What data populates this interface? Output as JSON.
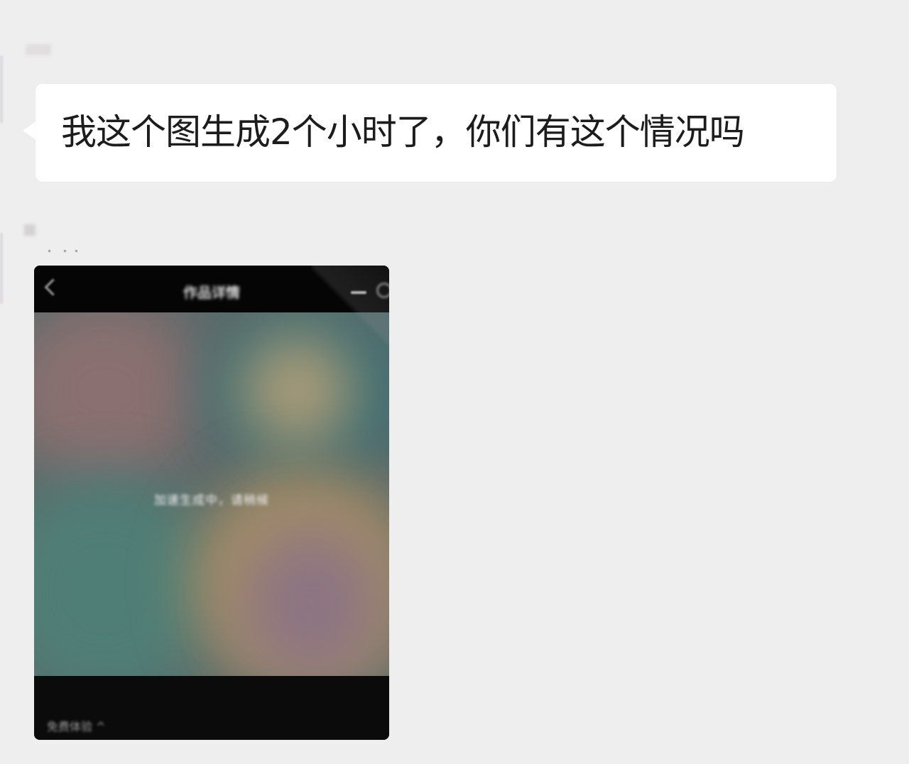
{
  "chat": {
    "message_1": {
      "text": "我这个图生成2个小时了，你们有这个情况吗"
    },
    "message_2": {
      "screenshot": {
        "header": {
          "title": "作品详情",
          "back_icon": "chevron-left-icon",
          "more_icon": "more-icon",
          "extra_icon": "target-icon"
        },
        "center_text": "加速生成中，请稍候",
        "footer_text": "免费体验 ^",
        "image_palette": [
          "#6b6f6c",
          "#3d6e72",
          "#b79b72",
          "#8a6c78",
          "#4f7a6e"
        ]
      }
    }
  }
}
